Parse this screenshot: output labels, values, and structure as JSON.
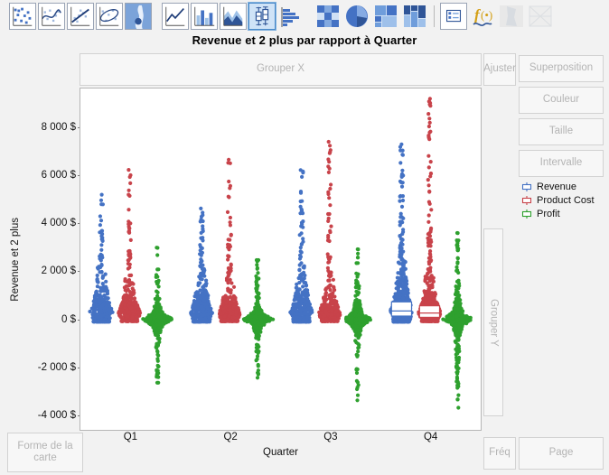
{
  "toolbar": {
    "icons": [
      {
        "name": "scatter-plot-icon",
        "selected": false
      },
      {
        "name": "smoother-curve-icon",
        "selected": false
      },
      {
        "name": "line-of-fit-icon",
        "selected": false
      },
      {
        "name": "ellipse-contour-icon",
        "selected": false
      },
      {
        "name": "contour-density-icon",
        "selected": false
      },
      {
        "name": "line-chart-icon",
        "selected": false
      },
      {
        "name": "bar-chart-icon",
        "selected": false
      },
      {
        "name": "area-chart-icon",
        "selected": false
      },
      {
        "name": "box-plot-icon",
        "selected": true
      },
      {
        "name": "histogram-icon",
        "selected": false
      },
      {
        "name": "heatmap-icon",
        "selected": false
      },
      {
        "name": "pie-chart-icon",
        "selected": false
      },
      {
        "name": "treemap-icon",
        "selected": false
      },
      {
        "name": "mosaic-chart-icon",
        "selected": false
      },
      {
        "name": "legend-settings-icon",
        "selected": false
      },
      {
        "name": "formula-function-icon",
        "selected": false
      },
      {
        "name": "map-shape-icon",
        "selected": false
      },
      {
        "name": "parallel-plot-icon",
        "selected": false
      }
    ]
  },
  "chart_title": "Revenue et 2 plus par rapport à Quarter",
  "dropzones": {
    "grouper_x": "Grouper X",
    "grouper_y": "Grouper Y",
    "ajuster": "Ajuster",
    "freq": "Fréq",
    "forme_de_la_carte": "Forme de la carte",
    "page": "Page"
  },
  "right_panel": {
    "superposition": "Superposition",
    "couleur": "Couleur",
    "taille": "Taille",
    "intervalle": "Intervalle"
  },
  "legend": {
    "items": [
      {
        "label": "Revenue",
        "color": "#4472c4",
        "icon": "box-plot-marker-icon"
      },
      {
        "label": "Product Cost",
        "color": "#c8434a",
        "icon": "box-plot-marker-icon"
      },
      {
        "label": "Profit",
        "color": "#2ea02e",
        "icon": "box-plot-marker-icon"
      }
    ]
  },
  "chart_data": {
    "type": "scatter",
    "title": "Revenue et 2 plus par rapport à Quarter",
    "subtype": "jittered-dot-plot-with-box-plot",
    "xlabel": "Quarter",
    "ylabel": "Revenue et 2 plus",
    "categories": [
      "Q1",
      "Q2",
      "Q3",
      "Q4"
    ],
    "ylim": [
      -4600,
      9600
    ],
    "yticks": [
      -4000,
      -2000,
      0,
      2000,
      4000,
      6000,
      8000
    ],
    "ytick_labels": [
      "-4 000 $",
      "-2 000 $",
      "0 $",
      "2 000 $",
      "4 000 $",
      "6 000 $",
      "8 000 $"
    ],
    "ytick_format": "currency-dollar-space-thousands",
    "grid": false,
    "legend_position": "right",
    "series": [
      {
        "name": "Revenue",
        "color": "#4472c4",
        "groups": [
          {
            "category": "Q1",
            "n": 320,
            "median": 350,
            "q1": 150,
            "q3": 700,
            "min": -60,
            "max": 5400,
            "box_visible": false
          },
          {
            "category": "Q2",
            "n": 320,
            "median": 330,
            "q1": 140,
            "q3": 680,
            "min": -60,
            "max": 4900,
            "box_visible": false
          },
          {
            "category": "Q3",
            "n": 330,
            "median": 340,
            "q1": 150,
            "q3": 700,
            "min": -60,
            "max": 6250,
            "box_visible": false
          },
          {
            "category": "Q4",
            "n": 520,
            "median": 380,
            "q1": 170,
            "q3": 760,
            "min": -60,
            "max": 7550,
            "box_visible": true
          }
        ]
      },
      {
        "name": "Product Cost",
        "color": "#c8434a",
        "groups": [
          {
            "category": "Q1",
            "n": 320,
            "median": 280,
            "q1": 110,
            "q3": 560,
            "min": -40,
            "max": 6500,
            "box_visible": false
          },
          {
            "category": "Q2",
            "n": 320,
            "median": 260,
            "q1": 100,
            "q3": 540,
            "min": -40,
            "max": 6700,
            "box_visible": false
          },
          {
            "category": "Q3",
            "n": 330,
            "median": 270,
            "q1": 110,
            "q3": 550,
            "min": -40,
            "max": 7450,
            "box_visible": false
          },
          {
            "category": "Q4",
            "n": 520,
            "median": 300,
            "q1": 120,
            "q3": 600,
            "min": -40,
            "max": 9250,
            "box_visible": true
          }
        ]
      },
      {
        "name": "Profit",
        "color": "#2ea02e",
        "groups": [
          {
            "category": "Q1",
            "n": 320,
            "median": 40,
            "q1": -120,
            "q3": 220,
            "min": -2600,
            "max": 3150,
            "box_visible": false
          },
          {
            "category": "Q2",
            "n": 320,
            "median": 40,
            "q1": -120,
            "q3": 220,
            "min": -2400,
            "max": 2500,
            "box_visible": false
          },
          {
            "category": "Q3",
            "n": 330,
            "median": 40,
            "q1": -130,
            "q3": 230,
            "min": -3350,
            "max": 2950,
            "box_visible": false
          },
          {
            "category": "Q4",
            "n": 520,
            "median": 50,
            "q1": -140,
            "q3": 250,
            "min": -4050,
            "max": 3650,
            "box_visible": false
          }
        ]
      }
    ]
  }
}
